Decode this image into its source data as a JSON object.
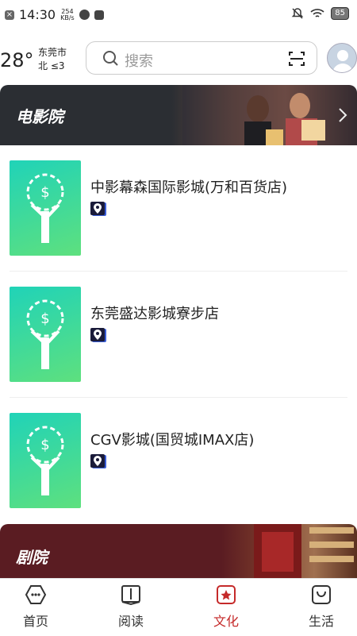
{
  "status": {
    "time": "14:30",
    "speed_value": "254",
    "speed_unit": "KB/s",
    "battery": "85"
  },
  "header": {
    "temperature": "28°",
    "city": "东莞市",
    "wind": "北 ≤3",
    "search_placeholder": "搜索"
  },
  "sections": {
    "cinema_title": "电影院",
    "theater_title": "剧院"
  },
  "cinemas": [
    {
      "name": "中影幕森国际影城(万和百货店)"
    },
    {
      "name": "东莞盛达影城寮步店"
    },
    {
      "name": "CGV影城(国贸城IMAX店)"
    }
  ],
  "tabs": [
    {
      "label": "首页",
      "icon": "home-chat-icon"
    },
    {
      "label": "阅读",
      "icon": "book-icon"
    },
    {
      "label": "文化",
      "icon": "star-culture-icon"
    },
    {
      "label": "生活",
      "icon": "bag-icon"
    }
  ],
  "colors": {
    "active_tab": "#c52a2a",
    "cinema_banner": "#2b2e33",
    "theater_banner": "#5a1c22",
    "thumb_gradient_start": "#20d3b8",
    "thumb_gradient_end": "#5ee07e"
  }
}
